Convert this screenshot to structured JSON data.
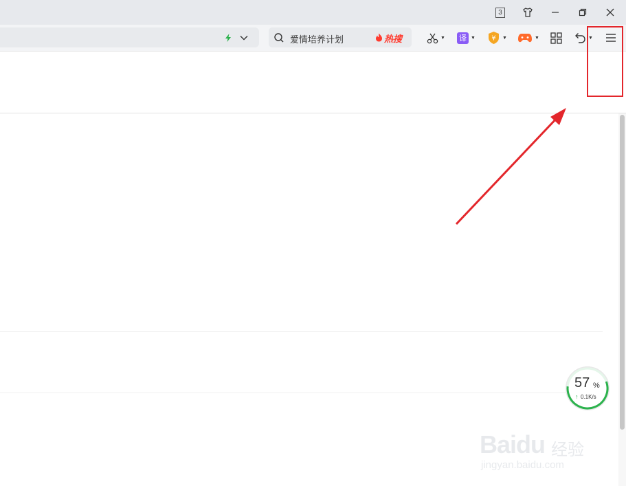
{
  "window": {
    "tab_count": "3"
  },
  "search": {
    "text": "爱情培养计划",
    "hot_label": "热搜"
  },
  "toolbar": {
    "translate_label": "译",
    "wallet_label": "¥"
  },
  "speed_monitor": {
    "percent": "57",
    "unit": "%",
    "rate": "0.1K/s"
  },
  "watermark": {
    "brand": "Baidu",
    "sub": "经验",
    "url": "jingyan.baidu.com"
  },
  "colors": {
    "annotation_red": "#e3262b",
    "hot_red": "#ff3b2f",
    "speed_green": "#2bb24c",
    "translate_purple": "#8a5cf6",
    "wallet_orange": "#f5a623",
    "game_orange": "#ff6a2b"
  }
}
